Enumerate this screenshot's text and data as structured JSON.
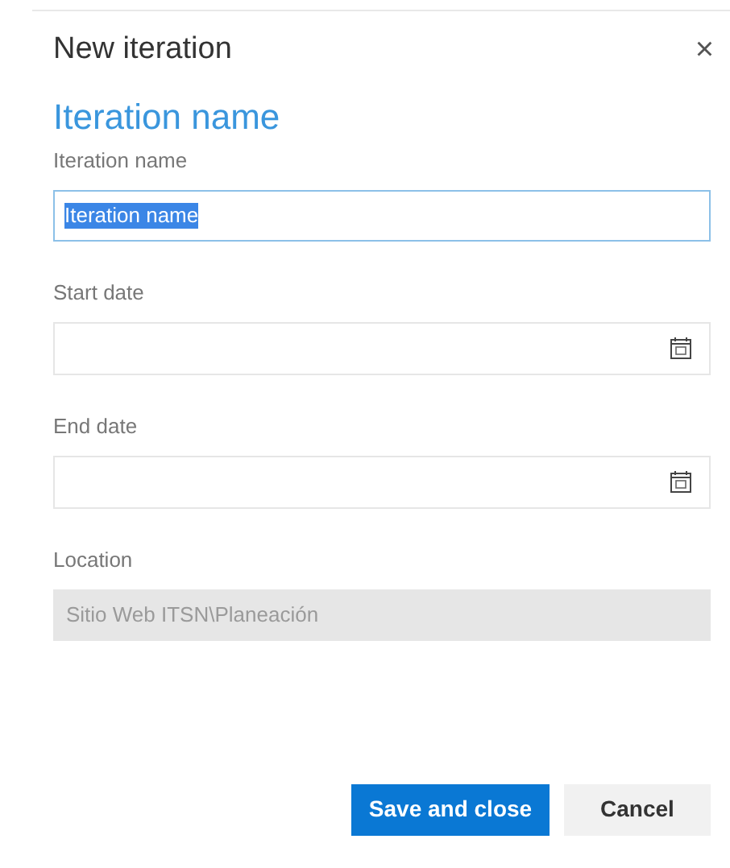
{
  "dialog": {
    "title": "New iteration",
    "close": "×",
    "heading": "Iteration name"
  },
  "fields": [
    {
      "kind": "text",
      "label": "Iteration name",
      "value": "Iteration name",
      "focused": true,
      "text_selected": true
    },
    {
      "kind": "date",
      "label": "Start date",
      "focused": false
    },
    {
      "kind": "date",
      "label": "End date",
      "focused": false
    },
    {
      "kind": "readonly",
      "label": "Location",
      "value": "Sitio Web ITSN\\Planeación",
      "disabled": true
    }
  ],
  "buttons": [
    {
      "kind": "primary",
      "label": "Save and close"
    },
    {
      "kind": "secondary",
      "label": "Cancel"
    }
  ]
}
